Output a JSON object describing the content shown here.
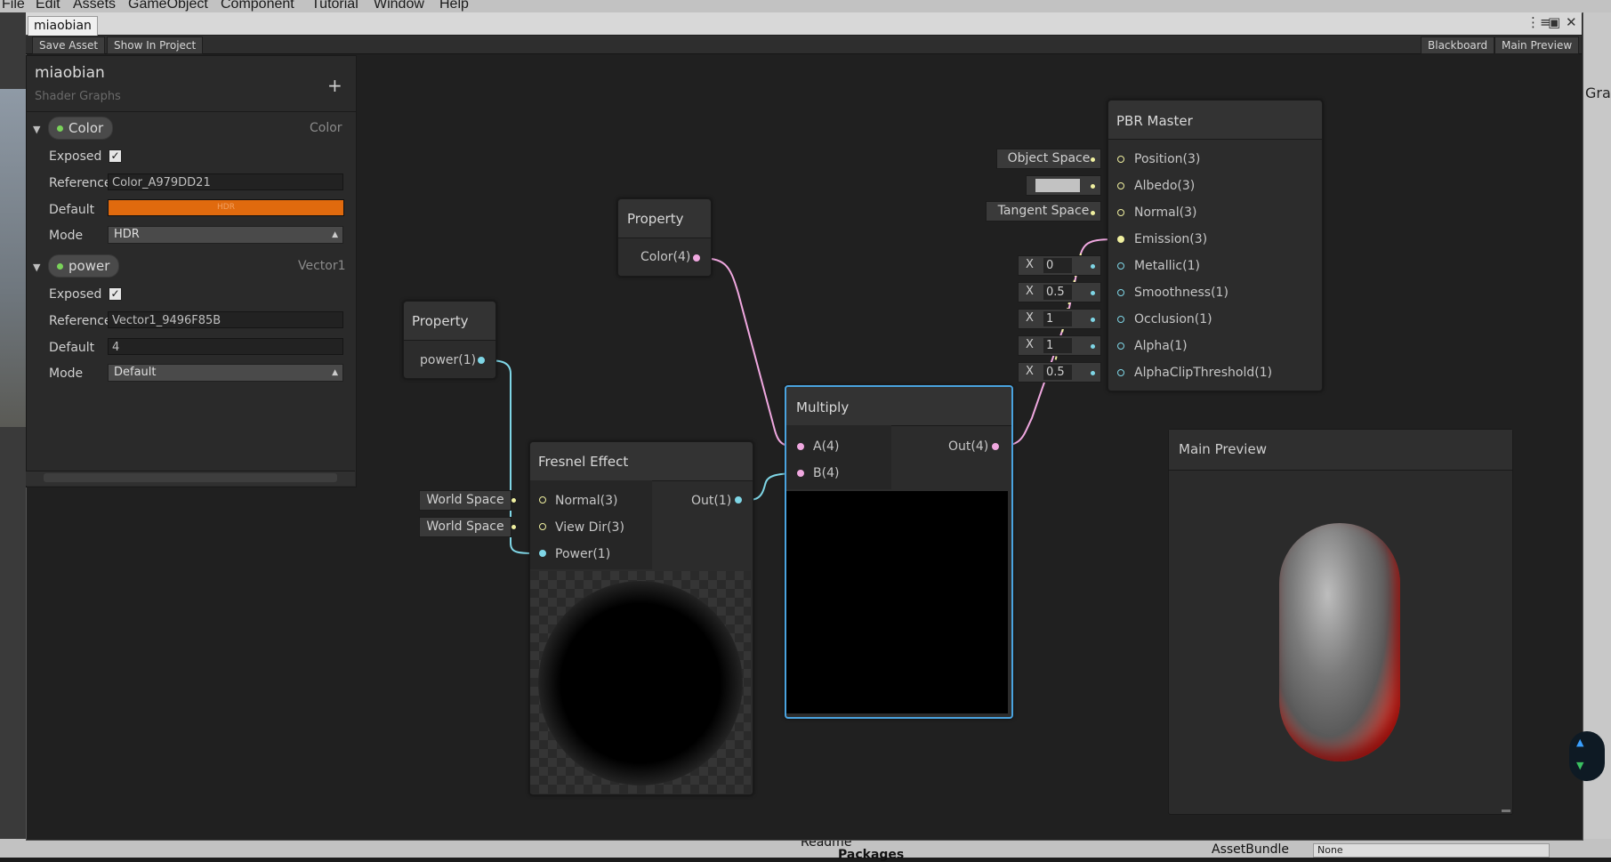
{
  "menubar": {
    "items": [
      "File",
      "Edit",
      "Assets",
      "GameObject",
      "Component",
      "Tutorial",
      "Window",
      "Help"
    ]
  },
  "window": {
    "tab_title": "miaobian"
  },
  "toolbar": {
    "save_asset": "Save Asset",
    "show_in_project": "Show In Project",
    "blackboard": "Blackboard",
    "main_preview": "Main Preview"
  },
  "blackboard": {
    "title": "miaobian",
    "subtitle": "Shader Graphs",
    "add": "+",
    "properties": [
      {
        "name": "Color",
        "type": "Color",
        "exposed_label": "Exposed",
        "exposed": true,
        "reference_label": "Reference",
        "reference": "Color_A979DD21",
        "default_label": "Default",
        "default_hdr": "HDR",
        "default_color": "#e06a0e",
        "mode_label": "Mode",
        "mode": "HDR"
      },
      {
        "name": "power",
        "type": "Vector1",
        "exposed_label": "Exposed",
        "exposed": true,
        "reference_label": "Reference",
        "reference": "Vector1_9496F85B",
        "default_label": "Default",
        "default": "4",
        "mode_label": "Mode",
        "mode": "Default"
      }
    ]
  },
  "nodes": {
    "property_color": {
      "title": "Property",
      "out": "Color(4)"
    },
    "property_power": {
      "title": "Property",
      "out": "power(1)"
    },
    "fresnel": {
      "title": "Fresnel Effect",
      "inputs": [
        "Normal(3)",
        "View Dir(3)",
        "Power(1)"
      ],
      "output": "Out(1)",
      "normal_default": "World Space",
      "viewdir_default": "World Space"
    },
    "multiply": {
      "title": "Multiply",
      "inputs": [
        "A(4)",
        "B(4)"
      ],
      "output": "Out(4)"
    },
    "pbr_master": {
      "title": "PBR Master",
      "ports": [
        "Position(3)",
        "Albedo(3)",
        "Normal(3)",
        "Emission(3)",
        "Metallic(1)",
        "Smoothness(1)",
        "Occlusion(1)",
        "Alpha(1)",
        "AlphaClipThreshold(1)"
      ],
      "position_default": "Object Space",
      "normal_default": "Tangent Space",
      "albedo_color": "#c2c2c2",
      "x_label": "X",
      "metallic": "0",
      "smoothness": "0.5",
      "occlusion": "1",
      "alpha": "1",
      "alpha_clip": "0.5"
    }
  },
  "main_preview": {
    "title": "Main Preview"
  },
  "background": {
    "readme": "Readme",
    "packages": "Packages",
    "asset_bundle_label": "AssetBundle",
    "asset_bundle_value": "None",
    "right_label": "Gra"
  },
  "colors": {
    "color_edge": "#f0a8e0",
    "vector1_edge": "#7fd6e6",
    "vector3_edge": "#f0f0a0",
    "accent_select": "#4aa3df"
  }
}
